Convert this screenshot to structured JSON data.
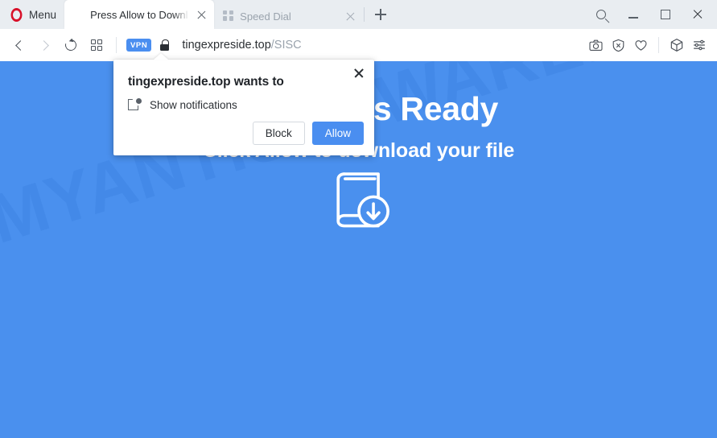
{
  "browser": {
    "menu_label": "Menu",
    "opera_logo_icon": "opera-o-icon",
    "tabs": [
      {
        "title": "Press Allow to Downl",
        "favicon": "document-icon",
        "active": true
      },
      {
        "title": "Speed Dial",
        "favicon": "grid-icon",
        "active": false
      }
    ],
    "new_tab_icon": "plus-icon",
    "window_controls": {
      "search_icon": "search-icon",
      "minimize_icon": "minimize-icon",
      "maximize_icon": "maximize-icon",
      "close_icon": "close-icon"
    },
    "toolbar": {
      "back_icon": "chevron-left-icon",
      "forward_icon": "chevron-right-icon",
      "reload_icon": "reload-icon",
      "speeddial_icon": "speed-dial-grid-icon",
      "vpn_badge": "VPN",
      "lock_icon": "padlock-icon",
      "url_domain": "tingexpreside.top",
      "url_path": "/SISC",
      "url_full": "tingexpreside.top/SISC",
      "right_icons": [
        "camera-snapshot-icon",
        "ad-blocker-shield-icon",
        "heart-favorites-icon",
        "cube-extensions-icon",
        "easy-setup-sliders-icon"
      ]
    }
  },
  "page": {
    "background_color": "#4a90ee",
    "heading": "Your File Is Ready",
    "subheading": "Click Allow to download your file",
    "download_icon": "book-download-icon",
    "watermark": "MYANTISPYWARE.COM"
  },
  "notification_popup": {
    "title": "tingexpreside.top wants to",
    "permission_icon": "show-notifications-icon",
    "permission_label": "Show notifications",
    "block_label": "Block",
    "allow_label": "Allow",
    "close_icon": "close-icon",
    "allow_color": "#4a8ef0"
  }
}
